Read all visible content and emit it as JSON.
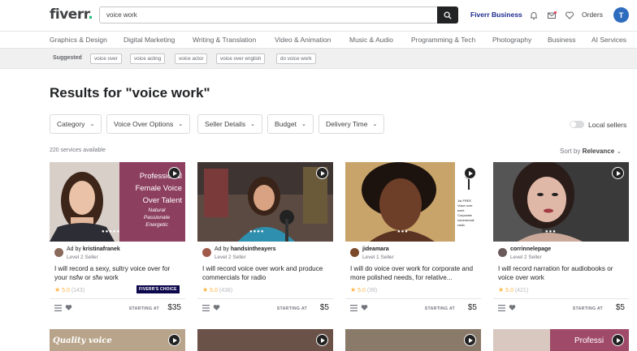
{
  "header": {
    "logo_text": "fiverr",
    "logo_dot": ".",
    "search_value": "voice work",
    "business_label": "Fiverr Business",
    "orders_label": "Orders",
    "avatar_initial": "T",
    "icons": [
      "search-icon",
      "bell-icon",
      "mail-icon",
      "heart-icon"
    ]
  },
  "categories": [
    "Graphics & Design",
    "Digital Marketing",
    "Writing & Translation",
    "Video & Animation",
    "Music & Audio",
    "Programming & Tech",
    "Photography",
    "Business",
    "AI Services"
  ],
  "suggested": {
    "label": "Suggested",
    "chips": [
      "voice over",
      "voice acting",
      "voice actor",
      "voice over english",
      "do voice work"
    ]
  },
  "results": {
    "title": "Results for \"voice work\"",
    "count": "220 services available",
    "sort_prefix": "Sort by",
    "sort_value": "Relevance",
    "local_sellers": "Local sellers",
    "filters": [
      "Category",
      "Voice Over Options",
      "Seller Details",
      "Budget",
      "Delivery Time"
    ]
  },
  "gigs": [
    {
      "ad_prefix": "Ad by",
      "seller": "kristinafranek",
      "level": "Level 2 Seller",
      "title": "I will record a sexy, sultry voice over for your nsfw or sfw work",
      "rating": "5.0",
      "reviews": "(143)",
      "badge": "FIVERR'S CHOICE",
      "starting_label": "STARTING AT",
      "price": "$35",
      "thumb_text": [
        "Professional",
        "Female Voice",
        "Over Talent"
      ],
      "thumb_tags": [
        "Natural",
        "Passionate",
        "Energetic"
      ]
    },
    {
      "ad_prefix": "Ad by",
      "seller": "handsintheayers",
      "level": "Level 2 Seller",
      "title": "I will record voice over work and produce commercials for radio",
      "rating": "5.0",
      "reviews": "(438)",
      "badge": "",
      "starting_label": "STARTING AT",
      "price": "$5"
    },
    {
      "ad_prefix": "",
      "seller": "jideamara",
      "level": "Level 1 Seller",
      "title": "I will do voice over work for corporate and more polished needs, for relative...",
      "rating": "5.0",
      "reviews": "(39)",
      "badge": "",
      "starting_label": "STARTING AT",
      "price": "$5",
      "thumb_bullets": [
        "1st FREE",
        "Voice over work",
        "Corporate commercial radio"
      ]
    },
    {
      "ad_prefix": "",
      "seller": "corrinnelepage",
      "level": "Level 2 Seller",
      "title": "I will record narration for audiobooks or voice over work",
      "rating": "5.0",
      "reviews": "(421)",
      "badge": "",
      "starting_label": "STARTING AT",
      "price": "$5"
    }
  ],
  "next_row": {
    "first_thumb_text": "Quality voice",
    "last_thumb_text": "Professi"
  },
  "colors": {
    "brand_green": "#1dbf73",
    "business_blue": "#1b2b8f",
    "star": "#ffb33e",
    "badge_bg": "#0d084d"
  }
}
